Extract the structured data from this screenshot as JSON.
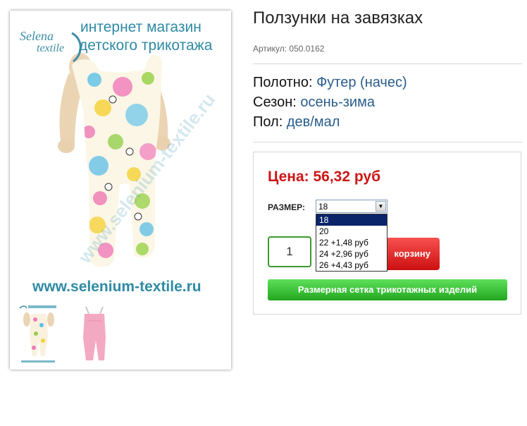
{
  "product": {
    "title": "Ползунки на завязках",
    "sku": "Артикул: 050.0162",
    "attributes": [
      {
        "label": "Полотно:",
        "value": "Футер (начес)"
      },
      {
        "label": "Сезон:",
        "value": "осень-зима"
      },
      {
        "label": "Пол:",
        "value": "дев/мал"
      }
    ]
  },
  "photo": {
    "logo_line1": "Selena",
    "logo_line2": "textile",
    "shop_line1": "интернет магазин",
    "shop_line2": "детского трикотажа",
    "watermark": "www.selenium-textile.ru",
    "url": "www.selenium-textile.ru"
  },
  "buy": {
    "price": "Цена: 56,32 руб",
    "size_label": "РАЗМЕР:",
    "size_selected": "18",
    "size_options": [
      "18",
      "20",
      "22 +1,48 руб",
      "24 +2,96 руб",
      "26 +4,43 руб"
    ],
    "quantity": "1",
    "cart_button": "корзину",
    "size_chart_button": "Размерная сетка трикотажных изделий"
  },
  "colors": {
    "price": "#cc1616",
    "link": "#2a5d8c",
    "cart": "#e02020",
    "size_chart": "#33b52e",
    "quantity_border": "#3a9a2e"
  }
}
